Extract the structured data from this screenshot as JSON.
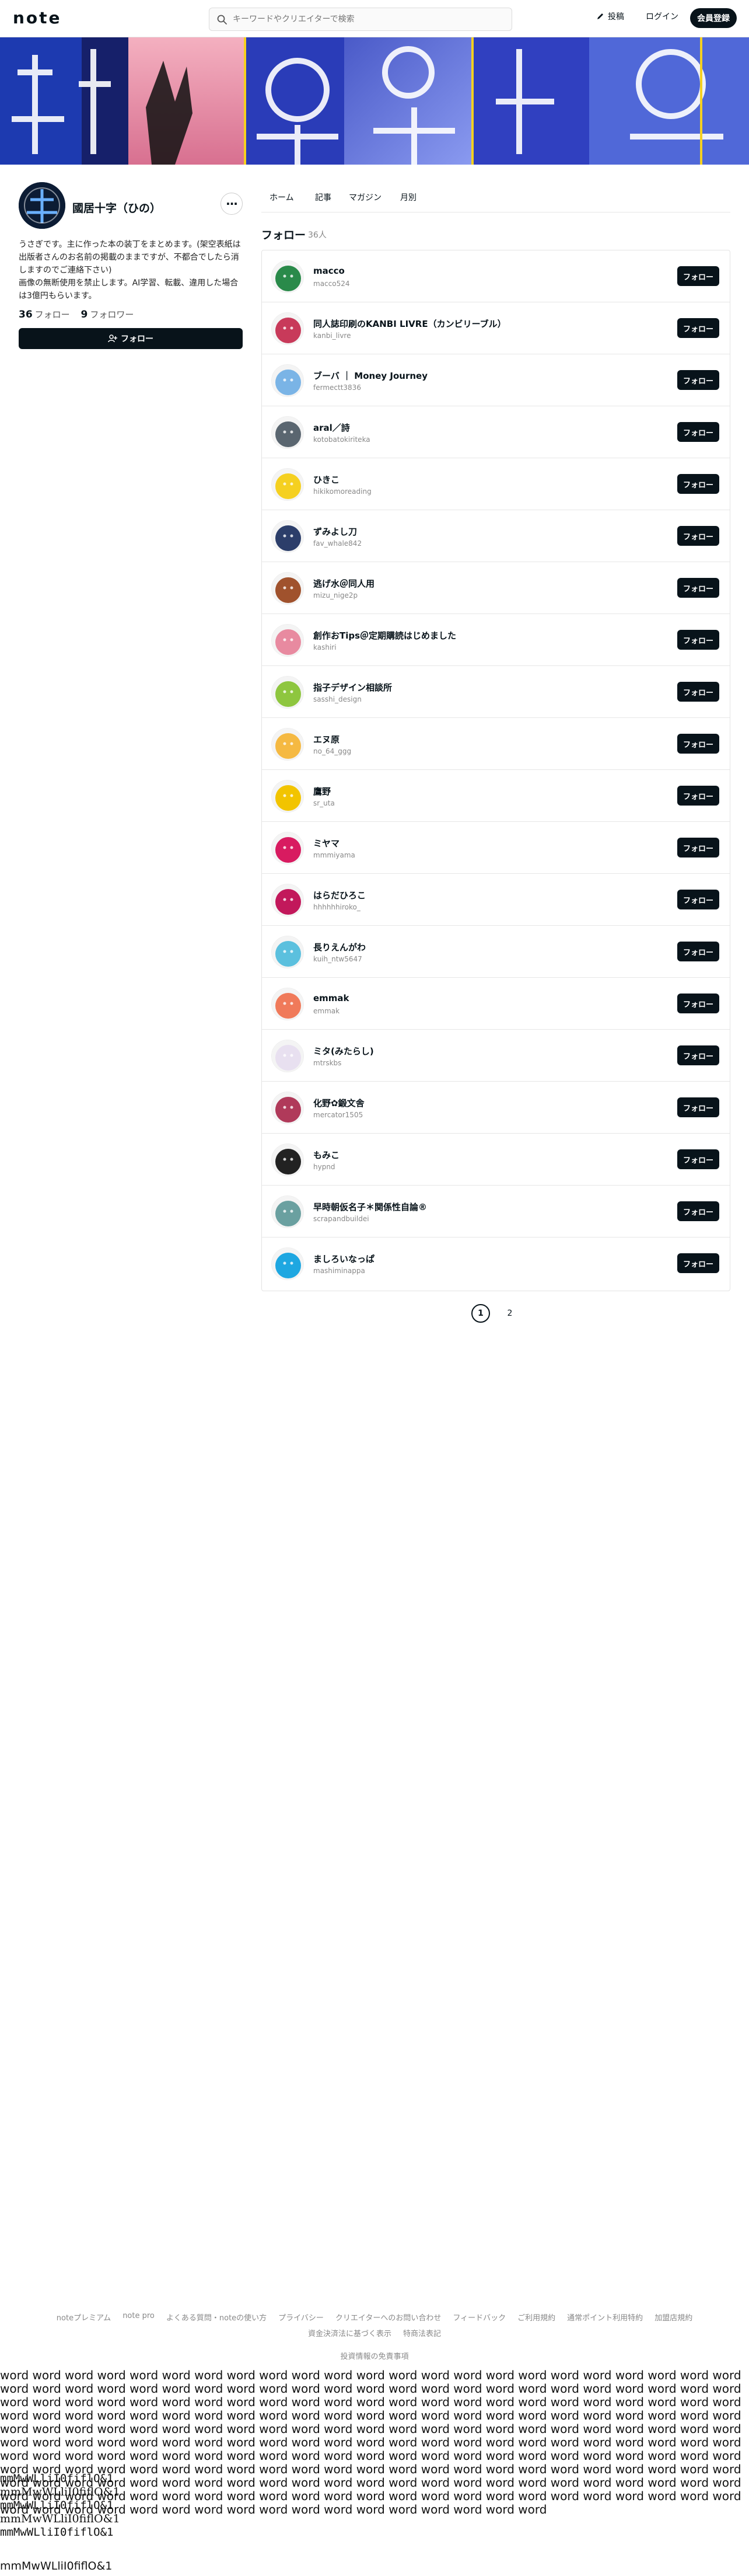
{
  "header": {
    "logo": "note",
    "search_placeholder": "キーワードやクリエイターで検索",
    "post_label": "投稿",
    "login_label": "ログイン",
    "signup_label": "会員登録"
  },
  "profile": {
    "name": "國居十字（ひの）",
    "bio": "うさぎです。主に作った本の装丁をまとめます。(架空表紙は出版者さんのお名前の掲載のままですが、不都合でしたら消しますのでご連絡下さい)\n画像の無断使用を禁止します。AI学習、転載、違用した場合は3億円もらいます。",
    "following_count": "36",
    "following_label": "フォロー",
    "followers_count": "9",
    "followers_label": "フォロワー",
    "follow_label": "フォロー"
  },
  "tabs": [
    "ホーム",
    "記事",
    "マガジン",
    "月別"
  ],
  "list": {
    "title": "フォロー",
    "count": "36人",
    "follow_label": "フォロー",
    "users": [
      {
        "name": "macco",
        "id": "macco524",
        "color": "#2a8a4a"
      },
      {
        "name": "同人誌印刷のKANBI LIVRE（カンビリーブル）",
        "id": "kanbi_livre",
        "color": "#c83a5a"
      },
      {
        "name": "ブーバ ｜ Money Journey",
        "id": "fermectt3836",
        "color": "#7ab4e6"
      },
      {
        "name": "aral／詩",
        "id": "kotobatokiriteka",
        "color": "#5a6670"
      },
      {
        "name": "ひきこ",
        "id": "hikikomoreading",
        "color": "#f5d020"
      },
      {
        "name": "ずみよし刀",
        "id": "fav_whale842",
        "color": "#2c3e6a"
      },
      {
        "name": "逃げ水＠同人用",
        "id": "mizu_nige2p",
        "color": "#a0522d"
      },
      {
        "name": "創作おTips＠定期購読はじめました",
        "id": "kashiri",
        "color": "#e88aa0"
      },
      {
        "name": "指子デザイン相談所",
        "id": "sasshi_design",
        "color": "#8ec63f"
      },
      {
        "name": "エヌ原",
        "id": "no_64_ggg",
        "color": "#f5b942"
      },
      {
        "name": "鷹野",
        "id": "sr_uta",
        "color": "#f2c400"
      },
      {
        "name": "ミヤマ",
        "id": "mmmiyama",
        "color": "#d81b60"
      },
      {
        "name": "はらだひろこ",
        "id": "hhhhhhiroko_",
        "color": "#c2185b"
      },
      {
        "name": "長りえんがわ",
        "id": "kuih_ntw5647",
        "color": "#5bc0de"
      },
      {
        "name": "emmak",
        "id": "emmak",
        "color": "#f07a5a"
      },
      {
        "name": "ミタ(みたらし)",
        "id": "mtrskbs",
        "color": "#e8e0f0"
      },
      {
        "name": "化野✿鍛文舎",
        "id": "mercator1505",
        "color": "#b03a5a"
      },
      {
        "name": "もみこ",
        "id": "hypnd",
        "color": "#222222"
      },
      {
        "name": "早時朝仮名子＊関係性自論®",
        "id": "scrapandbuildei",
        "color": "#6aa0a0"
      },
      {
        "name": "ましろいなっぱ",
        "id": "mashiminappa",
        "color": "#1ea7e1"
      }
    ]
  },
  "pagination": [
    "1",
    "2"
  ],
  "footer": {
    "links": [
      "noteプレミアム",
      "note pro",
      "よくある質問・noteの使い方",
      "プライバシー",
      "クリエイターへのお問い合わせ",
      "フィードバック",
      "ご利用規約",
      "通常ポイント利用特約",
      "加盟店規約",
      "資金決済法に基づく表示",
      "特商法表記"
    ],
    "law": "投資情報の免責事項"
  },
  "filler": {
    "word_text": "word word word word word word word word word word word word word word word word word word word word word word word word word word word word word word word word word word word word word word word word word word word word word word word word word word word word word word word word word word word word word word word word word word word word word word word word word word word word word word word word word word word word word word word word word word word word word word word word word word word word word word word word word word word word word word word word word word word word word word word word word word word word word word word word word word word word word word word word word word word word word word word word word word word word word word word word word word word word word word word word word word word word word word word word word word word word word word word word word word word word word word word word word word word word word word word word word word word word word word word word word word word word word word word word word word word word word word word word word word word word word word word word word word word word word word word word word word word word word word word word word word word word word word word",
    "mono_lines": [
      "mmMwWLliI0fiflO&1",
      "mmMwWLliI0fiflO&1",
      "mmMwWLliI0fiflO&1",
      "mmMwWLliI0fiflO&1",
      "mmMwWLliI0fiflO&1"
    ],
    "last_line": "mmMwWLliI0fiflO&1"
  }
}
